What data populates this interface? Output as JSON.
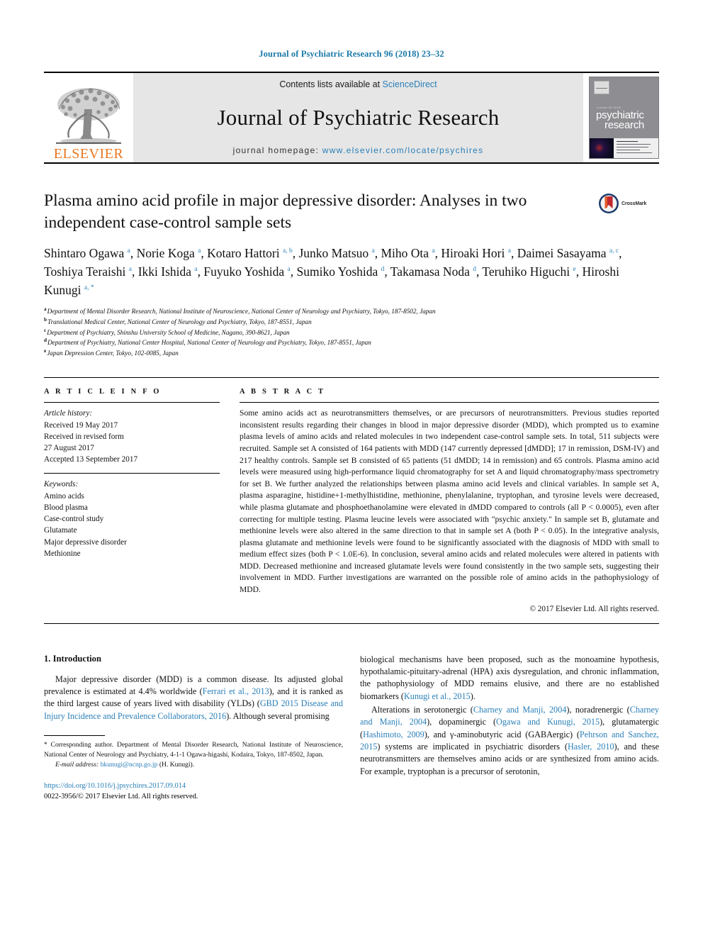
{
  "running_head": "Journal of Psychiatric Research 96 (2018) 23–32",
  "masthead": {
    "publisher_name": "ELSEVIER",
    "contents_prefix": "Contents lists available at ",
    "contents_link": "ScienceDirect",
    "journal_title": "Journal of Psychiatric Research",
    "homepage_prefix": "journal homepage: ",
    "homepage_url": "www.elsevier.com/locate/psychires",
    "cover": {
      "sub": "volume 96  2018",
      "title_line1": "psychiatric",
      "title_line2": "research"
    },
    "link_color": "#2a7fb8",
    "elsevier_orange": "#E87722"
  },
  "article": {
    "title": "Plasma amino acid profile in major depressive disorder: Analyses in two independent case-control sample sets",
    "crossmark_label": "CrossMark",
    "authors_html": "Shintaro Ogawa <sup>a</sup>, Norie Koga <sup>a</sup>, Kotaro Hattori <sup>a, b</sup>, Junko Matsuo <sup>a</sup>, Miho Ota <sup>a</sup>, Hiroaki Hori <sup>a</sup>, Daimei Sasayama <sup>a, c</sup>, Toshiya Teraishi <sup>a</sup>, Ikki Ishida <sup>a</sup>, Fuyuko Yoshida <sup>a</sup>, Sumiko Yoshida <sup>d</sup>, Takamasa Noda <sup>d</sup>, Teruhiko Higuchi <sup>e</sup>, Hiroshi Kunugi <sup>a, *</sup>",
    "affiliations": [
      {
        "mark": "a",
        "text": "Department of Mental Disorder Research, National Institute of Neuroscience, National Center of Neurology and Psychiatry, Tokyo, 187-8502, Japan"
      },
      {
        "mark": "b",
        "text": "Translational Medical Center, National Center of Neurology and Psychiatry, Tokyo, 187-8551, Japan"
      },
      {
        "mark": "c",
        "text": "Department of Psychiatry, Shinshu University School of Medicine, Nagano, 390-8621, Japan"
      },
      {
        "mark": "d",
        "text": "Department of Psychiatry, National Center Hospital, National Center of Neurology and Psychiatry, Tokyo, 187-8551, Japan"
      },
      {
        "mark": "e",
        "text": "Japan Depression Center, Tokyo, 102-0085, Japan"
      }
    ]
  },
  "article_info": {
    "heading": "A R T I C L E  I N F O",
    "history_label": "Article history:",
    "history": [
      "Received 19 May 2017",
      "Received in revised form",
      "27 August 2017",
      "Accepted 13 September 2017"
    ],
    "keywords_label": "Keywords:",
    "keywords": [
      "Amino acids",
      "Blood plasma",
      "Case-control study",
      "Glutamate",
      "Major depressive disorder",
      "Methionine"
    ]
  },
  "abstract": {
    "heading": "A B S T R A C T",
    "text": "Some amino acids act as neurotransmitters themselves, or are precursors of neurotransmitters. Previous studies reported inconsistent results regarding their changes in blood in major depressive disorder (MDD), which prompted us to examine plasma levels of amino acids and related molecules in two independent case-control sample sets. In total, 511 subjects were recruited. Sample set A consisted of 164 patients with MDD (147 currently depressed [dMDD]; 17 in remission, DSM-IV) and 217 healthy controls. Sample set B consisted of 65 patients (51 dMDD; 14 in remission) and 65 controls. Plasma amino acid levels were measured using high-performance liquid chromatography for set A and liquid chromatography/mass spectrometry for set B. We further analyzed the relationships between plasma amino acid levels and clinical variables. In sample set A, plasma asparagine, histidine+1-methylhistidine, methionine, phenylalanine, tryptophan, and tyrosine levels were decreased, while plasma glutamate and phosphoethanolamine were elevated in dMDD compared to controls (all P < 0.0005), even after correcting for multiple testing. Plasma leucine levels were associated with \"psychic anxiety.\" In sample set B, glutamate and methionine levels were also altered in the same direction to that in sample set A (both P < 0.05). In the integrative analysis, plasma glutamate and methionine levels were found to be significantly associated with the diagnosis of MDD with small to medium effect sizes (both P < 1.0E-6). In conclusion, several amino acids and related molecules were altered in patients with MDD. Decreased methionine and increased glutamate levels were found consistently in the two sample sets, suggesting their involvement in MDD. Further investigations are warranted on the possible role of amino acids in the pathophysiology of MDD.",
    "copyright": "© 2017 Elsevier Ltd. All rights reserved."
  },
  "introduction": {
    "heading": "1.  Introduction",
    "left_para_html": "Major depressive disorder (MDD) is a common disease. Its adjusted global prevalence is estimated at 4.4% worldwide (<span class=\"ref\">Ferrari et al., 2013</span>), and it is ranked as the third largest cause of years lived with disability (YLDs) (<span class=\"ref\">GBD 2015 Disease and Injury Incidence and Prevalence Collaborators, 2016</span>). Although several promising",
    "right_para1_html": "biological mechanisms have been proposed, such as the monoamine hypothesis, hypothalamic-pituitary-adrenal (HPA) axis dysregulation, and chronic inflammation, the pathophysiology of MDD remains elusive, and there are no established biomarkers (<span class=\"ref\">Kunugi et al., 2015</span>).",
    "right_para2_html": "Alterations in serotonergic (<span class=\"ref\">Charney and Manji, 2004</span>), noradrenergic (<span class=\"ref\">Charney and Manji, 2004</span>), dopaminergic (<span class=\"ref\">Ogawa and Kunugi, 2015</span>), glutamatergic (<span class=\"ref\">Hashimoto, 2009</span>), and &gamma;-aminobutyric acid (GABAergic) (<span class=\"ref\">Pehrson and Sanchez, 2015</span>) systems are implicated in psychiatric disorders (<span class=\"ref\">Hasler, 2010</span>), and these neurotransmitters are themselves amino acids or are synthesized from amino acids. For example, tryptophan is a precursor of serotonin,"
  },
  "footer": {
    "corresponding_html": "<span class=\"star\">*</span> Corresponding author. Department of Mental Disorder Research, National Institute of Neuroscience, National Center of Neurology and Psychiatry, 4-1-1 Ogawa-higashi, Kodaira, Tokyo, 187-8502, Japan.",
    "email_label": "E-mail address:",
    "email": "hkunugi@ncnp.go.jp",
    "email_owner": "(H. Kunugi).",
    "doi": "https://doi.org/10.1016/j.jpsychires.2017.09.014",
    "issn_line": "0022-3956/© 2017 Elsevier Ltd. All rights reserved."
  }
}
